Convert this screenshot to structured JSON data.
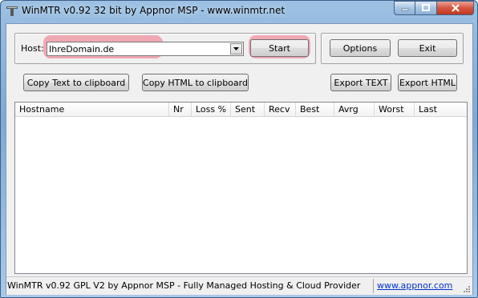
{
  "window": {
    "title": "WinMTR v0.92 32 bit by Appnor MSP - www.winmtr.net"
  },
  "host": {
    "label": "Host:",
    "value": "IhreDomain.de"
  },
  "buttons": {
    "start": "Start",
    "options": "Options",
    "exit": "Exit",
    "copy_text": "Copy Text to clipboard",
    "copy_html": "Copy HTML to clipboard",
    "export_text": "Export TEXT",
    "export_html": "Export HTML"
  },
  "columns": [
    "Hostname",
    "Nr",
    "Loss %",
    "Sent",
    "Recv",
    "Best",
    "Avrg",
    "Worst",
    "Last"
  ],
  "status": {
    "text": "WinMTR v0.92 GPL V2 by Appnor MSP - Fully Managed Hosting & Cloud Provider",
    "link": "www.appnor.com"
  },
  "colors": {
    "highlight": "#f06e82",
    "link": "#0033cc",
    "close": "#c0381f"
  }
}
